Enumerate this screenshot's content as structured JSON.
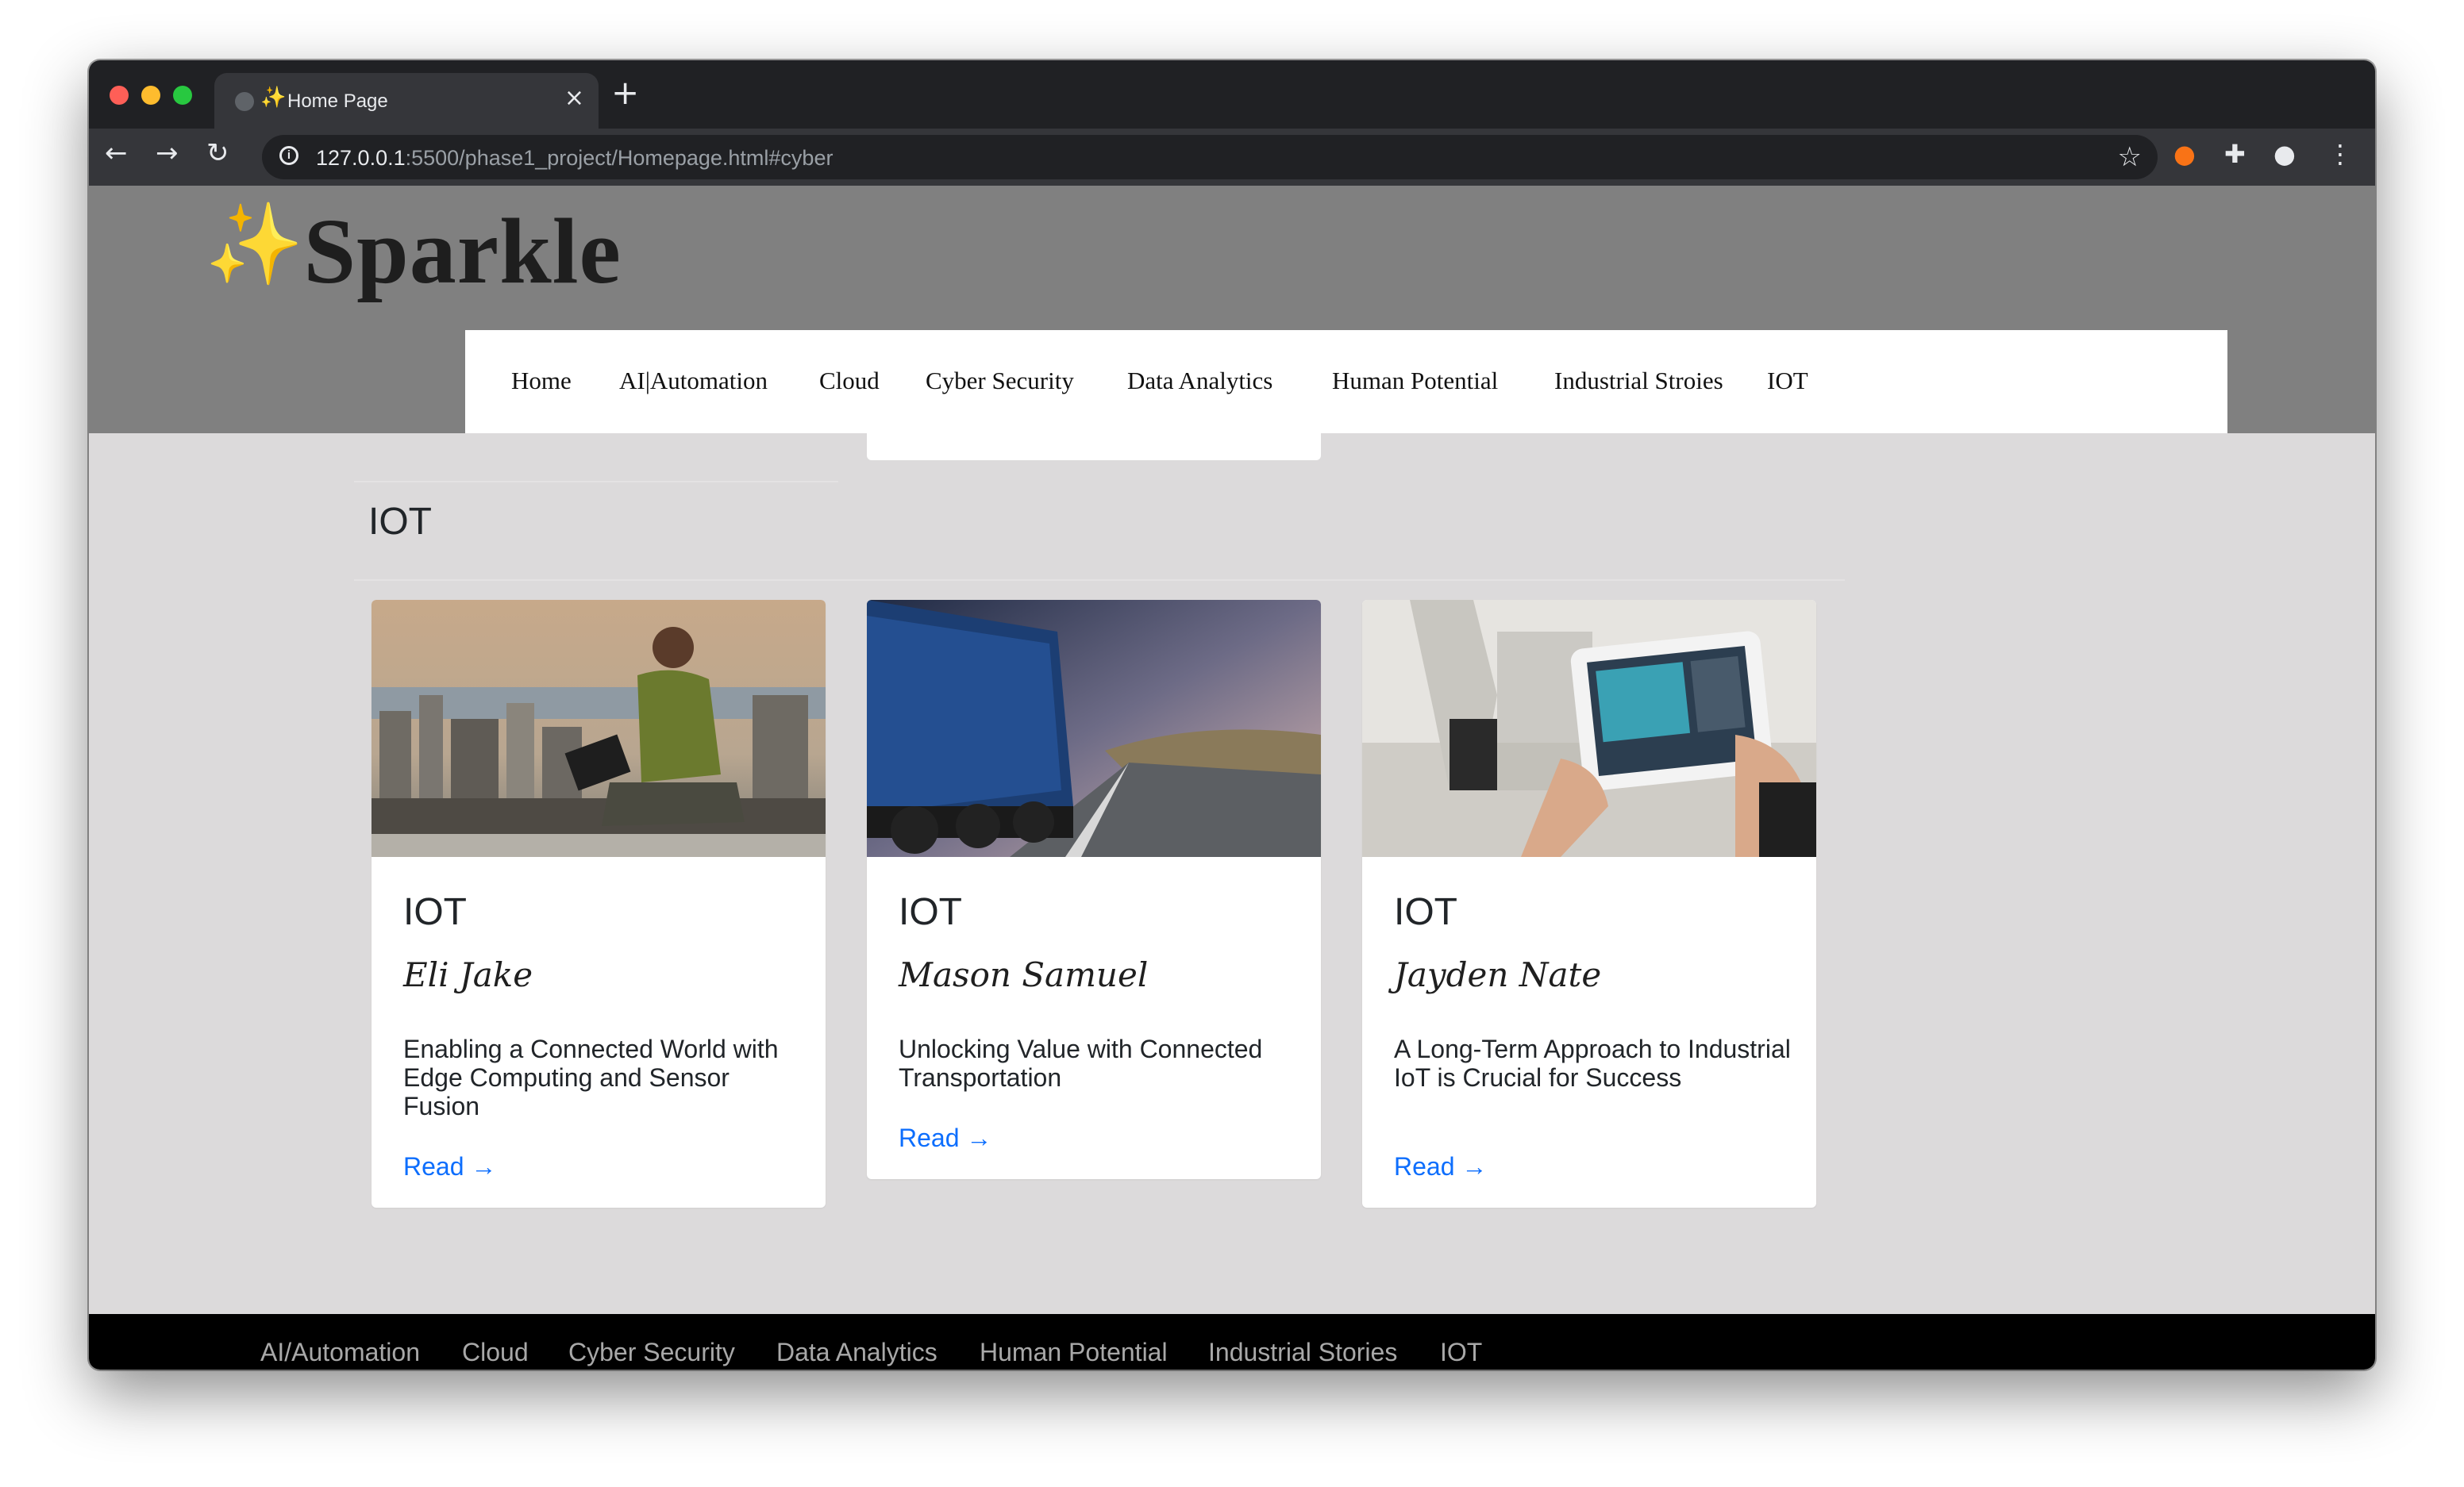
{
  "browser": {
    "tab_title": "Home Page",
    "tab_favicon": "✨",
    "url_host": "127.0.0.1",
    "url_rest": ":5500/phase1_project/Homepage.html#cyber"
  },
  "site": {
    "brand": "Sparkle",
    "logo_icon": "✨",
    "nav": [
      "Home",
      "AI|Automation",
      "Cloud",
      "Cyber Security",
      "Data Analytics",
      "Human Potential",
      "Industrial Stroies",
      "IOT"
    ]
  },
  "section": {
    "title": "IOT"
  },
  "cards": [
    {
      "category": "IOT",
      "author": "Eli Jake",
      "text": "Enabling a Connected World with Edge Computing and Sensor Fusion",
      "read": "Read →"
    },
    {
      "category": "IOT",
      "author": "Mason Samuel",
      "text": "Unlocking Value with Connected Transportation",
      "read": "Read →"
    },
    {
      "category": "IOT",
      "author": "Jayden Nate",
      "text": "A Long-Term Approach to Industrial IoT is Crucial for Success",
      "read": "Read →"
    }
  ],
  "footer": {
    "links": [
      "AI/Automation",
      "Cloud",
      "Cyber Security",
      "Data Analytics",
      "Human Potential",
      "Industrial Stories",
      "IOT"
    ],
    "social_icons": [
      "facebook-icon",
      "twitter-icon",
      "linkedin-icon",
      "youtube-icon"
    ]
  },
  "colors": {
    "link": "#0d6efd",
    "header_bg": "#808080",
    "page_bg": "#dcdadb",
    "footer_bg": "#000000"
  }
}
